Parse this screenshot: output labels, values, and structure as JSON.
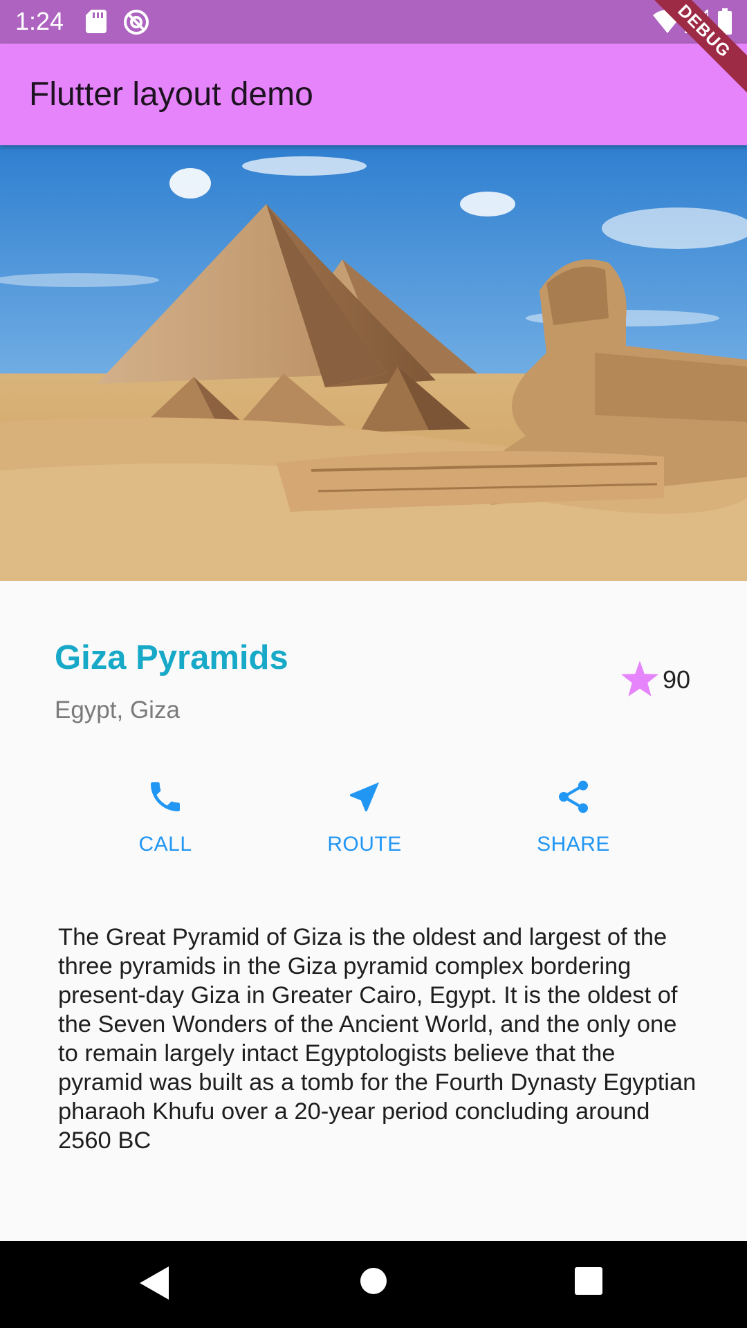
{
  "status_bar": {
    "time": "1:24",
    "left_icons": [
      "sd-card-icon",
      "sync-disabled-icon"
    ],
    "right_icons": [
      "wifi-icon",
      "cell-signal-icon",
      "battery-icon"
    ]
  },
  "debug_banner": "DEBUG",
  "app_bar": {
    "title": "Flutter layout demo"
  },
  "place": {
    "name": "Giza Pyramids",
    "location": "Egypt, Giza",
    "rating_icon": "star-icon",
    "rating_count": "90"
  },
  "actions": [
    {
      "label": "CALL",
      "icon": "phone-icon"
    },
    {
      "label": "ROUTE",
      "icon": "near-me-icon"
    },
    {
      "label": "SHARE",
      "icon": "share-icon"
    }
  ],
  "description": "The Great Pyramid of Giza is the oldest and largest of the three pyramids in the Giza pyramid complex bordering present-day Giza in Greater Cairo, Egypt. It is the oldest of the Seven Wonders of the Ancient World, and the only one to remain largely intact Egyptologists believe that the pyramid was built as a tomb for the Fourth Dynasty Egyptian pharaoh Khufu over a 20-year period concluding around 2560 BC",
  "nav_bar": {
    "buttons": [
      "back-icon",
      "home-icon",
      "recents-icon"
    ]
  },
  "colors": {
    "status_bar": "#ad63bf",
    "app_bar": "#e684fb",
    "title": "#17a9c7",
    "accent": "#2196f3",
    "star": "#e684fb"
  }
}
